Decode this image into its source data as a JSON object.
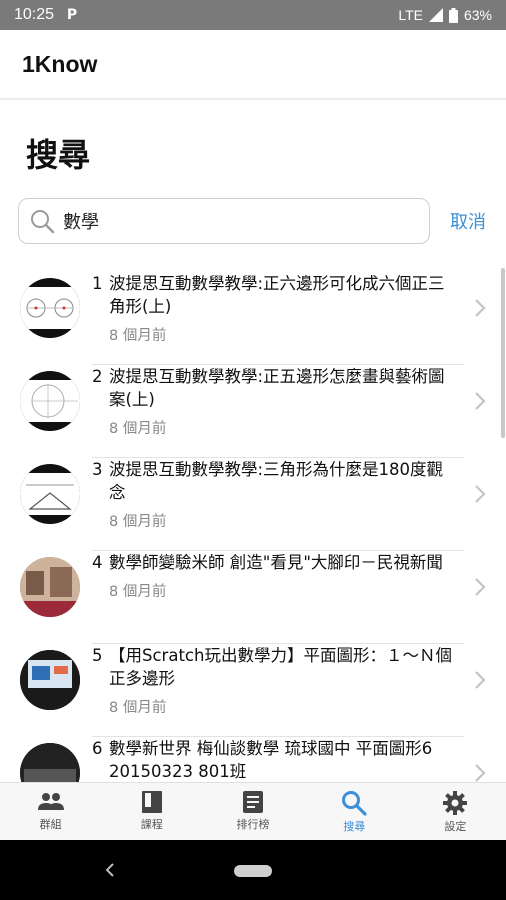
{
  "status": {
    "time": "10:25",
    "notification": "P",
    "network": "LTE",
    "battery": "63%"
  },
  "app": {
    "title": "1Know"
  },
  "page": {
    "title": "搜尋"
  },
  "search": {
    "value": "數學",
    "cancel_label": "取消"
  },
  "results": [
    {
      "num": "1",
      "title": "波提思互動數學教學:正六邊形可化成六個正三角形(上)",
      "time": "8 個月前"
    },
    {
      "num": "2",
      "title": "波提思互動數學教學:正五邊形怎麼畫與藝術圖案(上)",
      "time": "8 個月前"
    },
    {
      "num": "3",
      "title": "波提思互動數學教學:三角形為什麼是180度觀念",
      "time": "8 個月前"
    },
    {
      "num": "4",
      "title": "數學師變驗米師 創造\"看見\"大腳印－民視新聞",
      "time": "8 個月前"
    },
    {
      "num": "5",
      "title": "【用Scratch玩出數學力】平面圖形：１～Ｎ個正多邊形",
      "time": "8 個月前"
    },
    {
      "num": "6",
      "title": "數學新世界 梅仙談數學 琉球國中 平面圖形6 20150323 801班",
      "time": ""
    }
  ],
  "nav": [
    {
      "label": "群組",
      "icon": "group-icon"
    },
    {
      "label": "課程",
      "icon": "book-icon"
    },
    {
      "label": "排行榜",
      "icon": "list-icon"
    },
    {
      "label": "搜尋",
      "icon": "search-icon",
      "active": true
    },
    {
      "label": "設定",
      "icon": "gear-icon"
    }
  ],
  "colors": {
    "accent": "#3d8fd8",
    "status_bar": "#7a7a7a"
  }
}
